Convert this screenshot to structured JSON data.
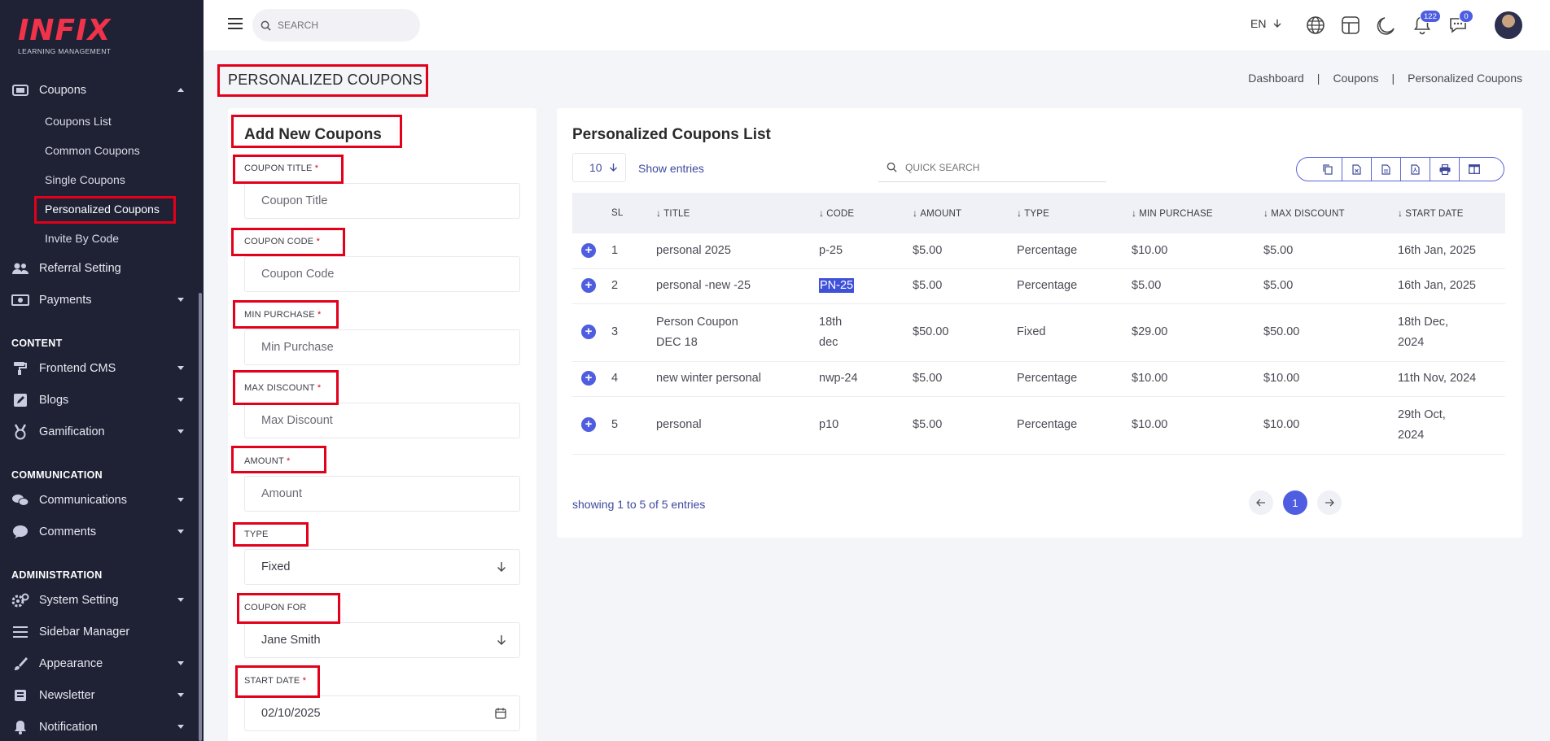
{
  "brand": {
    "logo_text": "INFIX",
    "logo_subtitle": "LEARNING MANAGEMENT"
  },
  "sidebar": {
    "coupons": {
      "label": "Coupons"
    },
    "coupon_subitems": [
      "Coupons List",
      "Common Coupons",
      "Single Coupons",
      "Personalized Coupons",
      "Invite By Code"
    ],
    "referral": "Referral Setting",
    "payments": "Payments",
    "section_content": "CONTENT",
    "frontend_cms": "Frontend CMS",
    "blogs": "Blogs",
    "gamification": "Gamification",
    "section_communication": "COMMUNICATION",
    "communications": "Communications",
    "comments": "Comments",
    "section_administration": "ADMINISTRATION",
    "system_setting": "System Setting",
    "sidebar_manager": "Sidebar Manager",
    "appearance": "Appearance",
    "newsletter": "Newsletter",
    "notification": "Notification"
  },
  "topbar": {
    "search_placeholder": "SEARCH",
    "language": "EN",
    "notifications_count": "122",
    "messages_count": "0"
  },
  "page": {
    "title": "PERSONALIZED COUPONS",
    "breadcrumb": [
      "Dashboard",
      "Coupons",
      "Personalized Coupons"
    ],
    "breadcrumb_separator": "|"
  },
  "form": {
    "title": "Add New Coupons",
    "required_mark": "*",
    "coupon_title_label": "COUPON TITLE",
    "coupon_title_placeholder": "Coupon Title",
    "coupon_code_label": "COUPON CODE",
    "coupon_code_placeholder": "Coupon Code",
    "min_purchase_label": "MIN PURCHASE",
    "min_purchase_placeholder": "Min Purchase",
    "max_discount_label": "MAX DISCOUNT",
    "max_discount_placeholder": "Max Discount",
    "amount_label": "AMOUNT",
    "amount_placeholder": "Amount",
    "type_label": "TYPE",
    "type_value": "Fixed",
    "coupon_for_label": "COUPON FOR",
    "coupon_for_value": "Jane Smith",
    "start_date_label": "START DATE",
    "start_date_value": "02/10/2025"
  },
  "list": {
    "title": "Personalized Coupons List",
    "entries_value": "10",
    "show_entries": "Show entries",
    "quick_search_placeholder": "QUICK SEARCH",
    "columns": [
      "SL",
      "TITLE",
      "CODE",
      "AMOUNT",
      "TYPE",
      "MIN PURCHASE",
      "MAX DISCOUNT",
      "START DATE"
    ],
    "rows": [
      [
        "1",
        "personal 2025",
        "p-25",
        "$5.00",
        "Percentage",
        "$10.00",
        "$5.00",
        "16th Jan, 2025"
      ],
      [
        "2",
        "personal -new -25",
        "PN-25",
        "$5.00",
        "Percentage",
        "$5.00",
        "$5.00",
        "16th Jan, 2025"
      ],
      [
        "3",
        "Person Coupon DEC 18",
        "18th dec",
        "$50.00",
        "Fixed",
        "$29.00",
        "$50.00",
        "18th Dec, 2024"
      ],
      [
        "4",
        "new winter personal",
        "nwp-24",
        "$5.00",
        "Percentage",
        "$10.00",
        "$10.00",
        "11th Nov, 2024"
      ],
      [
        "5",
        "personal",
        "p10",
        "$5.00",
        "Percentage",
        "$10.00",
        "$10.00",
        "29th Oct, 2024"
      ]
    ],
    "showing": "showing 1 to 5 of 5 entries",
    "current_page": "1"
  },
  "colors": {
    "sidebar_bg": "#1f2235",
    "accent": "#4f5ee0",
    "highlight_border": "#e3001b"
  }
}
